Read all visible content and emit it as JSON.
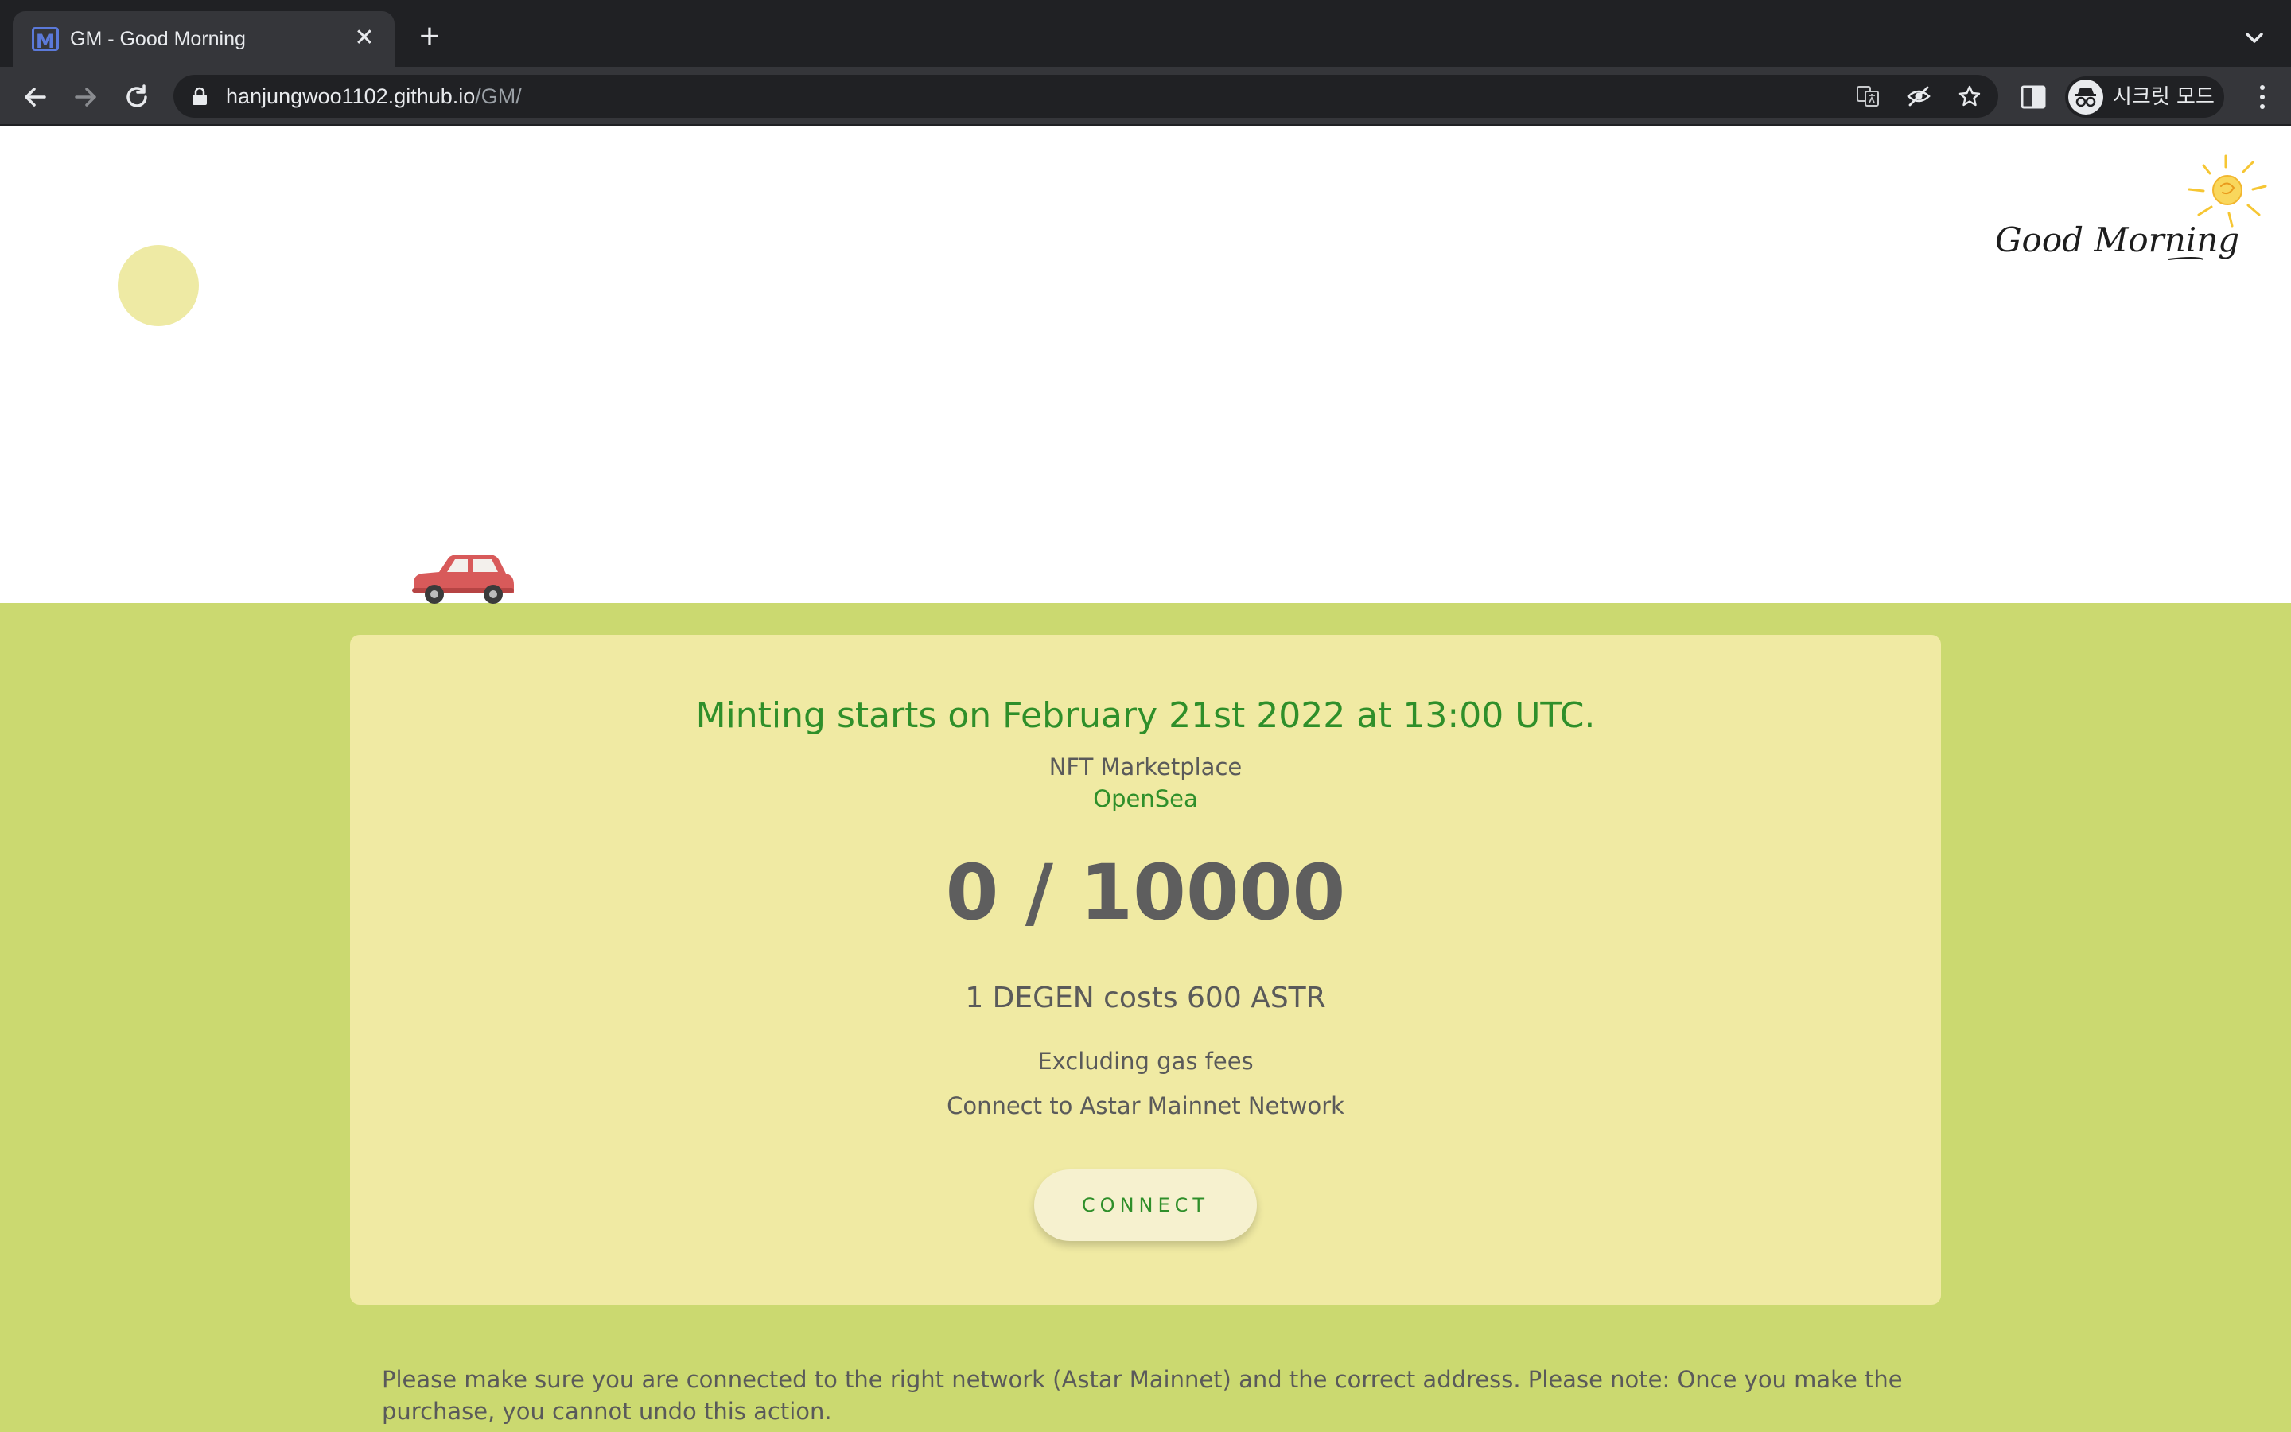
{
  "browser": {
    "tab": {
      "favicon": "gm-favicon-icon",
      "title": "GM - Good Morning",
      "close_icon": "close-icon"
    },
    "new_tab_icon": "plus-icon",
    "tab_list_icon": "chevron-down-icon",
    "nav": {
      "back_icon": "back-arrow-icon",
      "forward_icon": "forward-arrow-icon",
      "reload_icon": "reload-icon"
    },
    "address": {
      "lock_icon": "lock-icon",
      "host": "hanjungwoo1102.github.io",
      "path": "/GM/"
    },
    "omnibox_icons": [
      "translate-icon",
      "eye-off-icon",
      "star-icon"
    ],
    "side_panel_icon": "side-panel-icon",
    "profile": {
      "icon": "incognito-icon",
      "label": "시크릿 모드"
    },
    "menu_icon": "more-vert-icon"
  },
  "hero": {
    "logo_text": "Good Morning",
    "logo_icon": "sun-icon",
    "car_icon": "red-car-icon"
  },
  "mint": {
    "title": "Minting starts on February 21st 2022 at 13:00 UTC.",
    "marketplace_label": "NFT Marketplace",
    "marketplace_link": "OpenSea",
    "counter": "0 / 10000",
    "minted": 0,
    "supply": 10000,
    "cost": "1 DEGEN costs 600 ASTR",
    "gas_note": "Excluding gas fees",
    "network_note": "Connect to Astar Mainnet Network",
    "connect_label": "CONNECT"
  },
  "disclaimer": "Please make sure you are connected to the right network (Astar Mainnet) and the correct address. Please note: Once you make the purchase, you cannot undo this action.",
  "colors": {
    "page_bg": "#cbd970",
    "card_bg": "#f0eaa3",
    "accent_green": "#2f8f2a",
    "car_red": "#d85a5a",
    "sun_yellow": "#f6c633"
  }
}
